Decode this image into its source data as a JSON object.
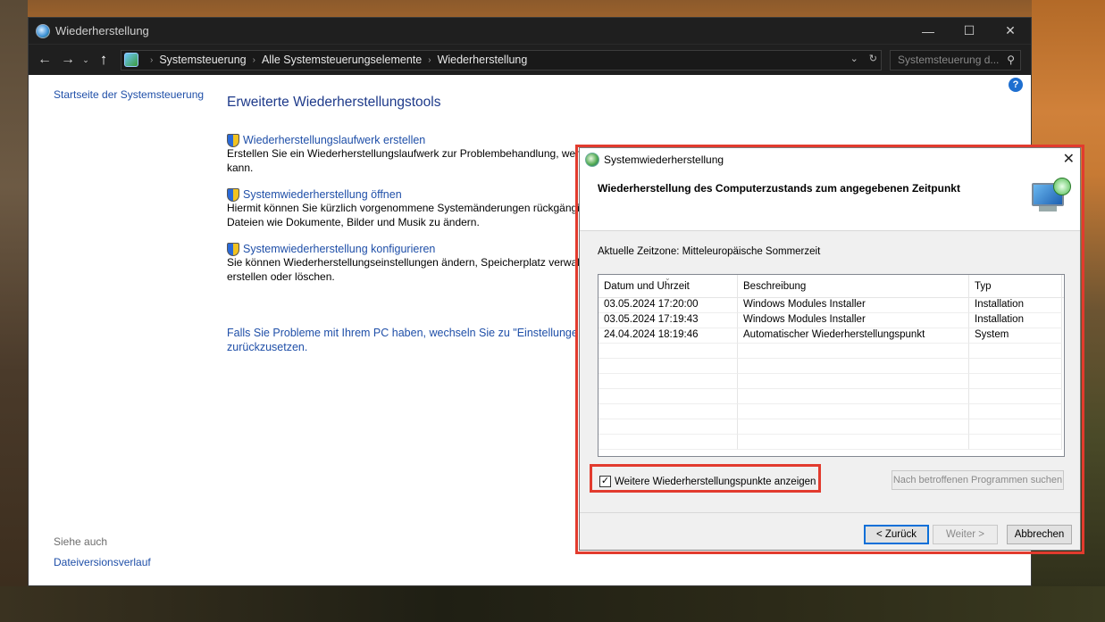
{
  "window": {
    "title": "Wiederherstellung",
    "controls": {
      "minimize": "—",
      "maximize": "☐",
      "close": "✕"
    }
  },
  "address": {
    "crumbs": [
      "Systemsteuerung",
      "Alle Systemsteuerungselemente",
      "Wiederherstellung"
    ],
    "search_placeholder": "Systemsteuerung d..."
  },
  "sidebar": {
    "home": "Startseite der Systemsteuerung",
    "see_also": "Siehe auch",
    "file_history": "Dateiversionsverlauf"
  },
  "main": {
    "heading": "Erweiterte Wiederherstellungstools",
    "tasks": [
      {
        "title": "Wiederherstellungslaufwerk erstellen",
        "desc1": "Erstellen Sie ein Wiederherstellungslaufwerk zur Problembehandlung, wenn Ihr PC nicht starten",
        "desc2": "kann."
      },
      {
        "title": "Systemwiederherstellung öffnen",
        "desc1": "Hiermit können Sie kürzlich vorgenommene Systemänderungen rückgängig machen, ohne",
        "desc2": "Dateien wie Dokumente, Bilder und Musik zu ändern."
      },
      {
        "title": "Systemwiederherstellung konfigurieren",
        "desc1": "Sie können Wiederherstellungseinstellungen ändern, Speicherplatz verwalten und",
        "desc2": "erstellen oder löschen."
      }
    ],
    "tip_line1": "Falls Sie Probleme mit Ihrem PC haben, wechseln Sie zu \"Einstellungen\", um ihn",
    "tip_line2": "zurückzusetzen."
  },
  "dialog": {
    "title": "Systemwiederherstellung",
    "heading": "Wiederherstellung des Computerzustands zum angegebenen Zeitpunkt",
    "timezone": "Aktuelle Zeitzone: Mitteleuropäische Sommerzeit",
    "columns": [
      "Datum und Uhrzeit",
      "Beschreibung",
      "Typ"
    ],
    "rows": [
      [
        "03.05.2024 17:20:00",
        "Windows Modules Installer",
        "Installation"
      ],
      [
        "03.05.2024 17:19:43",
        "Windows Modules Installer",
        "Installation"
      ],
      [
        "24.04.2024 18:19:46",
        "Automatischer Wiederherstellungspunkt",
        "System"
      ]
    ],
    "show_more_label": "Weitere Wiederherstellungspunkte anzeigen",
    "show_more_checked": true,
    "scan_button": "Nach betroffenen Programmen suchen",
    "back_button": "< Zurück",
    "next_button": "Weiter >",
    "cancel_button": "Abbrechen"
  },
  "colors": {
    "link": "#1f4fa8",
    "heading": "#1e3a8a",
    "highlight": "#e23b2e",
    "titlebar": "#1f1f1f"
  }
}
